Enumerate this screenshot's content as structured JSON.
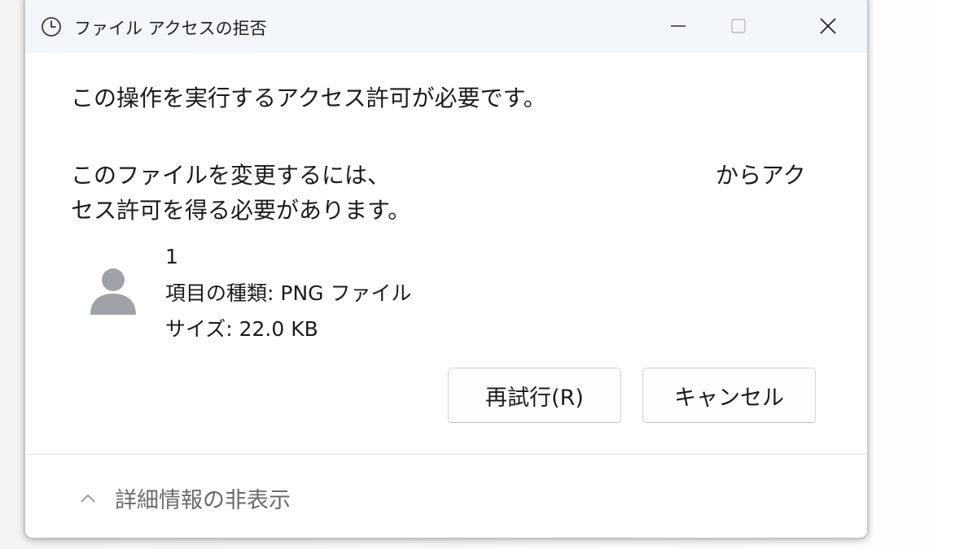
{
  "window": {
    "title": "ファイル アクセスの拒否",
    "controls": {
      "minimize": "minimize-icon",
      "maximize": "maximize-icon",
      "close": "close-icon"
    }
  },
  "message": {
    "main": "この操作を実行するアクセス許可が必要です。",
    "detail_line1_start": "このファイルを変更するには、",
    "detail_line1_end": "からアク",
    "detail_line2": "セス許可を得る必要があります。"
  },
  "file": {
    "name": "1",
    "type": "項目の種類: PNG ファイル",
    "size": "サイズ: 22.0 KB"
  },
  "buttons": {
    "retry": "再試行(R)",
    "cancel": "キャンセル"
  },
  "details_toggle": {
    "label": "詳細情報の非表示",
    "icon": "chevron-up-icon"
  },
  "colors": {
    "titlebar_bg": "#f3f6fb",
    "button_border": "#d3d3d3",
    "secondary_text": "#6b6b6b"
  }
}
